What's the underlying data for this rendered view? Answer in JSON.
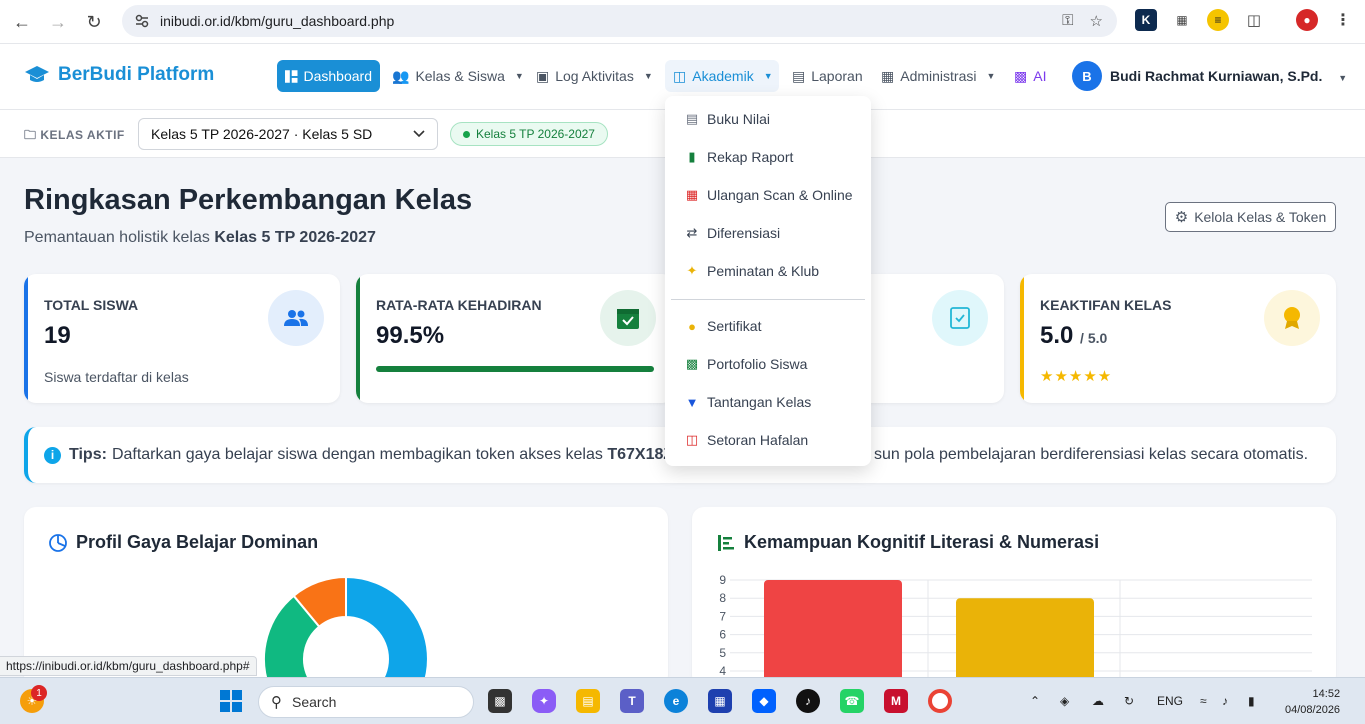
{
  "browser": {
    "url": "inibudi.or.id/kbm/guru_dashboard.php",
    "status_url": "https://inibudi.or.id/kbm/guru_dashboard.php#"
  },
  "nav": {
    "brand": "BerBudi Platform",
    "items": [
      {
        "label": "Dashboard"
      },
      {
        "label": "Kelas & Siswa"
      },
      {
        "label": "Log Aktivitas"
      },
      {
        "label": "Akademik"
      },
      {
        "label": "Laporan"
      },
      {
        "label": "Administrasi"
      },
      {
        "label": "AI"
      }
    ],
    "user_initial": "B",
    "user_name": "Budi Rachmat Kurniawan, S.Pd."
  },
  "classbar": {
    "label": "KELAS AKTIF",
    "selected": "Kelas 5 TP 2026-2027 · Kelas 5 SD",
    "badge": "Kelas 5 TP 2026-2027"
  },
  "page": {
    "title": "Ringkasan Perkembangan Kelas",
    "subtitle_prefix": "Pemantauan holistik kelas",
    "subtitle_class": "Kelas 5 TP 2026-2027",
    "manage_button": "Kelola Kelas & Token"
  },
  "cards": {
    "total": {
      "label": "TOTAL SISWA",
      "value": "19",
      "note": "Siswa terdaftar di kelas"
    },
    "attendance": {
      "label": "RATA-RATA KEHADIRAN",
      "value": "99.5%",
      "progress": 0.995
    },
    "activity": {
      "label": "KEAKTIFAN KELAS",
      "value": "5.0",
      "max": "/ 5.0",
      "stars": 5
    }
  },
  "tips": {
    "label": "Tips:",
    "text_start": "Daftarkan gaya belajar siswa dengan membagikan token akses kelas",
    "token": "T67X18Z",
    "text_end": "sun pola pembelajaran berdiferensiasi kelas secara otomatis."
  },
  "panels": {
    "left_title": "Profil Gaya Belajar Dominan",
    "right_title": "Kemampuan Kognitif Literasi & Numerasi"
  },
  "dropdown": {
    "items": [
      {
        "label": "Buku Nilai"
      },
      {
        "label": "Rekap Raport"
      },
      {
        "label": "Ulangan Scan & Online"
      },
      {
        "label": "Diferensiasi"
      },
      {
        "label": "Peminatan & Klub"
      },
      {
        "label": "Sertifikat"
      },
      {
        "label": "Portofolio Siswa"
      },
      {
        "label": "Tantangan Kelas"
      },
      {
        "label": "Setoran Hafalan"
      }
    ]
  },
  "chart_data": [
    {
      "type": "pie",
      "values": [
        0.5,
        0.39,
        0.11
      ],
      "colors": [
        "#0ea5e9",
        "#10b981",
        "#f97316"
      ]
    },
    {
      "type": "bar",
      "values": [
        9,
        8
      ],
      "colors": [
        "#ef4444",
        "#eab308"
      ],
      "yticks": [
        4,
        5,
        6,
        7,
        8,
        9
      ]
    }
  ],
  "taskbar": {
    "search": "Search",
    "lang": "ENG",
    "time": "14:52",
    "date": "04/08/2026",
    "badge": "1"
  }
}
